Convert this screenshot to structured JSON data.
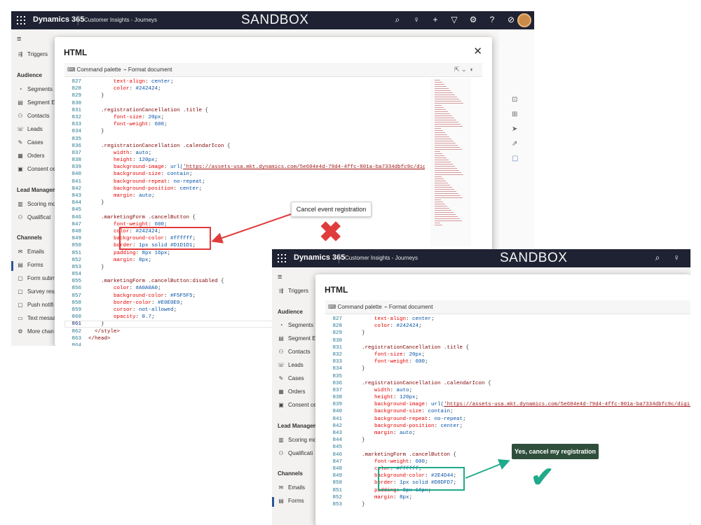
{
  "app": {
    "brand": "Dynamics 365",
    "subtitle": "Customer Insights - Journeys",
    "sandbox": "SANDBOX"
  },
  "nav": {
    "triggers": "Triggers",
    "audience_header": "Audience",
    "items_audience": [
      "Segments",
      "Segment E",
      "Contacts",
      "Leads",
      "Cases",
      "Orders",
      "Consent ce"
    ],
    "lead_header": "Lead Managem",
    "items_lead": [
      "Scoring mo",
      "Qualificat"
    ],
    "channels_header": "Channels",
    "items_channels_1": [
      "Emails",
      "Forms",
      "Form subm",
      "Survey resp",
      "Push notifi",
      "Text messa",
      "More chan"
    ],
    "items_lead_2": [
      "Scoring mo",
      "Qualificati"
    ],
    "items_channels_2": [
      "Emails",
      "Forms"
    ]
  },
  "modal": {
    "title": "HTML",
    "close": "✕",
    "command_palette": "Command palette",
    "format_document": "Format document"
  },
  "code1": [
    {
      "n": "827",
      "t": [
        [
          "        ",
          ""
        ],
        [
          "text-align",
          "prop"
        ],
        [
          ": ",
          "pun"
        ],
        [
          "center",
          "val"
        ],
        [
          ";",
          "pun"
        ]
      ]
    },
    {
      "n": "828",
      "t": [
        [
          "        ",
          ""
        ],
        [
          "color",
          "prop"
        ],
        [
          ": ",
          "pun"
        ],
        [
          "#242424",
          "val"
        ],
        [
          ";",
          "pun"
        ]
      ]
    },
    {
      "n": "829",
      "t": [
        [
          "    }",
          "pun"
        ]
      ]
    },
    {
      "n": "830",
      "t": [
        [
          "",
          ""
        ]
      ]
    },
    {
      "n": "831",
      "t": [
        [
          "    ",
          ""
        ],
        [
          ".registrationCancellation .title",
          "sel"
        ],
        [
          " {",
          "pun"
        ]
      ]
    },
    {
      "n": "832",
      "t": [
        [
          "        ",
          ""
        ],
        [
          "font-size",
          "prop"
        ],
        [
          ": ",
          "pun"
        ],
        [
          "20px",
          "val"
        ],
        [
          ";",
          "pun"
        ]
      ]
    },
    {
      "n": "833",
      "t": [
        [
          "        ",
          ""
        ],
        [
          "font-weight",
          "prop"
        ],
        [
          ": ",
          "pun"
        ],
        [
          "600",
          "val"
        ],
        [
          ";",
          "pun"
        ]
      ]
    },
    {
      "n": "834",
      "t": [
        [
          "    }",
          "pun"
        ]
      ]
    },
    {
      "n": "835",
      "t": [
        [
          "",
          ""
        ]
      ]
    },
    {
      "n": "836",
      "t": [
        [
          "    ",
          ""
        ],
        [
          ".registrationCancellation .calendarIcon",
          "sel"
        ],
        [
          " {",
          "pun"
        ]
      ]
    },
    {
      "n": "837",
      "t": [
        [
          "        ",
          ""
        ],
        [
          "width",
          "prop"
        ],
        [
          ": ",
          "pun"
        ],
        [
          "auto",
          "val"
        ],
        [
          ";",
          "pun"
        ]
      ]
    },
    {
      "n": "838",
      "t": [
        [
          "        ",
          ""
        ],
        [
          "height",
          "prop"
        ],
        [
          ": ",
          "pun"
        ],
        [
          "120px",
          "val"
        ],
        [
          ";",
          "pun"
        ]
      ]
    },
    {
      "n": "839",
      "t": [
        [
          "        ",
          ""
        ],
        [
          "background-image",
          "prop"
        ],
        [
          ": ",
          "pun"
        ],
        [
          "url(",
          "val"
        ],
        [
          "'https://assets-usa.mkt.dynamics.com/5e604e4d-79d4-4ffc-801a-ba7334dbfc9c/digitalas",
          "url"
        ]
      ]
    },
    {
      "n": "840",
      "t": [
        [
          "        ",
          ""
        ],
        [
          "background-size",
          "prop"
        ],
        [
          ": ",
          "pun"
        ],
        [
          "contain",
          "val"
        ],
        [
          ";",
          "pun"
        ]
      ]
    },
    {
      "n": "841",
      "t": [
        [
          "        ",
          ""
        ],
        [
          "background-repeat",
          "prop"
        ],
        [
          ": ",
          "pun"
        ],
        [
          "no-repeat",
          "val"
        ],
        [
          ";",
          "pun"
        ]
      ]
    },
    {
      "n": "842",
      "t": [
        [
          "        ",
          ""
        ],
        [
          "background-position",
          "prop"
        ],
        [
          ": ",
          "pun"
        ],
        [
          "center",
          "val"
        ],
        [
          ";",
          "pun"
        ]
      ]
    },
    {
      "n": "843",
      "t": [
        [
          "        ",
          ""
        ],
        [
          "margin",
          "prop"
        ],
        [
          ": ",
          "pun"
        ],
        [
          "auto",
          "val"
        ],
        [
          ";",
          "pun"
        ]
      ]
    },
    {
      "n": "844",
      "t": [
        [
          "    }",
          "pun"
        ]
      ]
    },
    {
      "n": "845",
      "t": [
        [
          "",
          ""
        ]
      ]
    },
    {
      "n": "846",
      "t": [
        [
          "    ",
          ""
        ],
        [
          ".marketingForm .cancelButton",
          "sel"
        ],
        [
          " {",
          "pun"
        ]
      ]
    },
    {
      "n": "847",
      "t": [
        [
          "        ",
          ""
        ],
        [
          "font-weight",
          "prop"
        ],
        [
          ": ",
          "pun"
        ],
        [
          "600",
          "val"
        ],
        [
          ";",
          "pun"
        ]
      ]
    },
    {
      "n": "848",
      "t": [
        [
          "        ",
          ""
        ],
        [
          "color",
          "prop"
        ],
        [
          ": ",
          "pun"
        ],
        [
          "#242424",
          "val"
        ],
        [
          ";",
          "pun"
        ]
      ]
    },
    {
      "n": "849",
      "t": [
        [
          "        ",
          ""
        ],
        [
          "background-color",
          "prop"
        ],
        [
          ": ",
          "pun"
        ],
        [
          "#ffffff",
          "val"
        ],
        [
          ";",
          "pun"
        ]
      ]
    },
    {
      "n": "850",
      "t": [
        [
          "        ",
          ""
        ],
        [
          "border",
          "prop"
        ],
        [
          ": ",
          "pun"
        ],
        [
          "1px solid #D1D1D1",
          "val"
        ],
        [
          ";",
          "pun"
        ]
      ]
    },
    {
      "n": "851",
      "t": [
        [
          "        ",
          ""
        ],
        [
          "padding",
          "prop"
        ],
        [
          ": ",
          "pun"
        ],
        [
          "8px 16px",
          "val"
        ],
        [
          ";",
          "pun"
        ]
      ]
    },
    {
      "n": "852",
      "t": [
        [
          "        ",
          ""
        ],
        [
          "margin",
          "prop"
        ],
        [
          ": ",
          "pun"
        ],
        [
          "8px",
          "val"
        ],
        [
          ";",
          "pun"
        ]
      ]
    },
    {
      "n": "853",
      "t": [
        [
          "    }",
          "pun"
        ]
      ]
    },
    {
      "n": "854",
      "t": [
        [
          "",
          ""
        ]
      ]
    },
    {
      "n": "855",
      "t": [
        [
          "    ",
          ""
        ],
        [
          ".marketingForm .cancelButton:disabled",
          "sel"
        ],
        [
          " {",
          "pun"
        ]
      ]
    },
    {
      "n": "856",
      "t": [
        [
          "        ",
          ""
        ],
        [
          "color",
          "prop"
        ],
        [
          ": ",
          "pun"
        ],
        [
          "#A0A0A0",
          "val"
        ],
        [
          ";",
          "pun"
        ]
      ]
    },
    {
      "n": "857",
      "t": [
        [
          "        ",
          ""
        ],
        [
          "background-color",
          "prop"
        ],
        [
          ": ",
          "pun"
        ],
        [
          "#F5F5F5",
          "val"
        ],
        [
          ";",
          "pun"
        ]
      ]
    },
    {
      "n": "858",
      "t": [
        [
          "        ",
          ""
        ],
        [
          "border-color",
          "prop"
        ],
        [
          ": ",
          "pun"
        ],
        [
          "#E0E0E0",
          "val"
        ],
        [
          ";",
          "pun"
        ]
      ]
    },
    {
      "n": "859",
      "t": [
        [
          "        ",
          ""
        ],
        [
          "cursor",
          "prop"
        ],
        [
          ": ",
          "pun"
        ],
        [
          "not-allowed",
          "val"
        ],
        [
          ";",
          "pun"
        ]
      ]
    },
    {
      "n": "860",
      "t": [
        [
          "        ",
          ""
        ],
        [
          "opacity",
          "prop"
        ],
        [
          ": ",
          "pun"
        ],
        [
          "0.7",
          "val"
        ],
        [
          ";",
          "pun"
        ]
      ]
    },
    {
      "n": "861",
      "t": [
        [
          "    }",
          "pun"
        ]
      ]
    },
    {
      "n": "862",
      "t": [
        [
          "  </",
          "tag"
        ],
        [
          "style",
          "tag"
        ],
        [
          ">",
          "tag"
        ]
      ]
    },
    {
      "n": "863",
      "t": [
        [
          "</",
          "tag"
        ],
        [
          "head",
          "tag"
        ],
        [
          ">",
          "tag"
        ]
      ]
    },
    {
      "n": "864",
      "t": [
        [
          "",
          ""
        ]
      ]
    }
  ],
  "code2": [
    {
      "n": "827",
      "t": [
        [
          "        ",
          ""
        ],
        [
          "text-align",
          "prop"
        ],
        [
          ": ",
          "pun"
        ],
        [
          "center",
          "val"
        ],
        [
          ";",
          "pun"
        ]
      ]
    },
    {
      "n": "828",
      "t": [
        [
          "        ",
          ""
        ],
        [
          "color",
          "prop"
        ],
        [
          ": ",
          "pun"
        ],
        [
          "#242424",
          "val"
        ],
        [
          ";",
          "pun"
        ]
      ]
    },
    {
      "n": "829",
      "t": [
        [
          "    }",
          "pun"
        ]
      ]
    },
    {
      "n": "830",
      "t": [
        [
          "",
          ""
        ]
      ]
    },
    {
      "n": "831",
      "t": [
        [
          "    ",
          ""
        ],
        [
          ".registrationCancellation .title",
          "sel"
        ],
        [
          " {",
          "pun"
        ]
      ]
    },
    {
      "n": "832",
      "t": [
        [
          "        ",
          ""
        ],
        [
          "font-size",
          "prop"
        ],
        [
          ": ",
          "pun"
        ],
        [
          "20px",
          "val"
        ],
        [
          ";",
          "pun"
        ]
      ]
    },
    {
      "n": "833",
      "t": [
        [
          "        ",
          ""
        ],
        [
          "font-weight",
          "prop"
        ],
        [
          ": ",
          "pun"
        ],
        [
          "600",
          "val"
        ],
        [
          ";",
          "pun"
        ]
      ]
    },
    {
      "n": "834",
      "t": [
        [
          "    }",
          "pun"
        ]
      ]
    },
    {
      "n": "835",
      "t": [
        [
          "",
          ""
        ]
      ]
    },
    {
      "n": "836",
      "t": [
        [
          "    ",
          ""
        ],
        [
          ".registrationCancellation .calendarIcon",
          "sel"
        ],
        [
          " {",
          "pun"
        ]
      ]
    },
    {
      "n": "837",
      "t": [
        [
          "        ",
          ""
        ],
        [
          "width",
          "prop"
        ],
        [
          ": ",
          "pun"
        ],
        [
          "auto",
          "val"
        ],
        [
          ";",
          "pun"
        ]
      ]
    },
    {
      "n": "838",
      "t": [
        [
          "        ",
          ""
        ],
        [
          "height",
          "prop"
        ],
        [
          ": ",
          "pun"
        ],
        [
          "120px",
          "val"
        ],
        [
          ";",
          "pun"
        ]
      ]
    },
    {
      "n": "839",
      "t": [
        [
          "        ",
          ""
        ],
        [
          "background-image",
          "prop"
        ],
        [
          ": ",
          "pun"
        ],
        [
          "url(",
          "val"
        ],
        [
          "'https://assets-usa.mkt.dynamics.com/5e604e4d-79d4-4ffc-801a-ba7334dbfc9c/digitalas",
          "url"
        ]
      ]
    },
    {
      "n": "840",
      "t": [
        [
          "        ",
          ""
        ],
        [
          "background-size",
          "prop"
        ],
        [
          ": ",
          "pun"
        ],
        [
          "contain",
          "val"
        ],
        [
          ";",
          "pun"
        ]
      ]
    },
    {
      "n": "841",
      "t": [
        [
          "        ",
          ""
        ],
        [
          "background-repeat",
          "prop"
        ],
        [
          ": ",
          "pun"
        ],
        [
          "no-repeat",
          "val"
        ],
        [
          ";",
          "pun"
        ]
      ]
    },
    {
      "n": "842",
      "t": [
        [
          "        ",
          ""
        ],
        [
          "background-position",
          "prop"
        ],
        [
          ": ",
          "pun"
        ],
        [
          "center",
          "val"
        ],
        [
          ";",
          "pun"
        ]
      ]
    },
    {
      "n": "843",
      "t": [
        [
          "        ",
          ""
        ],
        [
          "margin",
          "prop"
        ],
        [
          ": ",
          "pun"
        ],
        [
          "auto",
          "val"
        ],
        [
          ";",
          "pun"
        ]
      ]
    },
    {
      "n": "844",
      "t": [
        [
          "    }",
          "pun"
        ]
      ]
    },
    {
      "n": "845",
      "t": [
        [
          "",
          ""
        ]
      ]
    },
    {
      "n": "846",
      "t": [
        [
          "    ",
          ""
        ],
        [
          ".marketingForm .cancelButton",
          "sel"
        ],
        [
          " {",
          "pun"
        ]
      ]
    },
    {
      "n": "847",
      "t": [
        [
          "        ",
          ""
        ],
        [
          "font-weight",
          "prop"
        ],
        [
          ": ",
          "pun"
        ],
        [
          "600",
          "val"
        ],
        [
          ";",
          "pun"
        ]
      ]
    },
    {
      "n": "848",
      "t": [
        [
          "        ",
          ""
        ],
        [
          "color",
          "prop"
        ],
        [
          ": ",
          "pun"
        ],
        [
          "#ffffff",
          "val"
        ],
        [
          ";",
          "pun"
        ]
      ]
    },
    {
      "n": "849",
      "t": [
        [
          "        ",
          ""
        ],
        [
          "background-color",
          "prop"
        ],
        [
          ": ",
          "pun"
        ],
        [
          "#2E4D44",
          "val"
        ],
        [
          ";",
          "pun"
        ]
      ]
    },
    {
      "n": "850",
      "t": [
        [
          "        ",
          ""
        ],
        [
          "border",
          "prop"
        ],
        [
          ": ",
          "pun"
        ],
        [
          "1px solid #D8DFD7",
          "val"
        ],
        [
          ";",
          "pun"
        ]
      ]
    },
    {
      "n": "851",
      "t": [
        [
          "        ",
          ""
        ],
        [
          "padding",
          "prop"
        ],
        [
          ": ",
          "pun"
        ],
        [
          "8px 16px",
          "val"
        ],
        [
          ";",
          "pun"
        ]
      ]
    },
    {
      "n": "852",
      "t": [
        [
          "        ",
          ""
        ],
        [
          "margin",
          "prop"
        ],
        [
          ": ",
          "pun"
        ],
        [
          "8px",
          "val"
        ],
        [
          ";",
          "pun"
        ]
      ]
    },
    {
      "n": "853",
      "t": [
        [
          "    }",
          "pun"
        ]
      ]
    }
  ],
  "callouts": {
    "cancel_event": "Cancel event registration",
    "yes_cancel": "Yes, cancel my registration"
  },
  "colors": {
    "topbar": "#1f2232",
    "red_highlight": "#e03c3c",
    "green_highlight": "#1faa8a",
    "green_button": "#2f4f3c"
  }
}
